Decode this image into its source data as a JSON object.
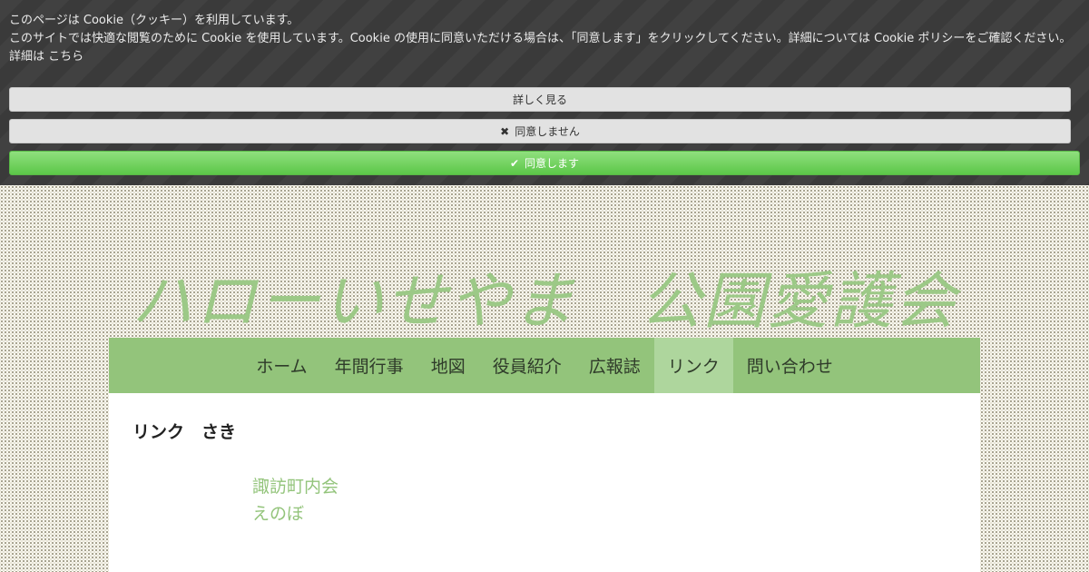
{
  "cookie": {
    "title_line": "このページは Cookie（クッキー）を利用しています。",
    "body_line": "このサイトでは快適な閲覧のために Cookie を使用しています。Cookie の使用に同意いただける場合は、「同意します」をクリックしてください。詳細については Cookie ポリシーをご確認ください。",
    "detail_prefix": "詳細は",
    "detail_link": "こちら",
    "buttons": {
      "detail": "詳しく見る",
      "decline": "同意しません",
      "accept": "同意します"
    },
    "icons": {
      "decline": "close-x-icon",
      "accept": "checkmark-icon"
    },
    "colors": {
      "banner_bg": "#3a3a3a",
      "accept_bg": "#5cc748",
      "button_bg": "#e2e2e2"
    }
  },
  "site": {
    "title": "ハローいせやま　公園愛護会",
    "title_color": "#9cc987"
  },
  "nav": {
    "items": [
      {
        "label": "ホーム"
      },
      {
        "label": "年間行事"
      },
      {
        "label": "地図"
      },
      {
        "label": "役員紹介"
      },
      {
        "label": "広報誌"
      },
      {
        "label": "リンク",
        "active": true
      },
      {
        "label": "問い合わせ"
      }
    ],
    "bg_color": "#93c47b",
    "active_color": "#aed69d"
  },
  "content": {
    "heading": "リンク　さき",
    "links": [
      {
        "label": "諏訪町内会"
      },
      {
        "label": "えのぼ"
      }
    ],
    "link_color": "#93c47b"
  }
}
